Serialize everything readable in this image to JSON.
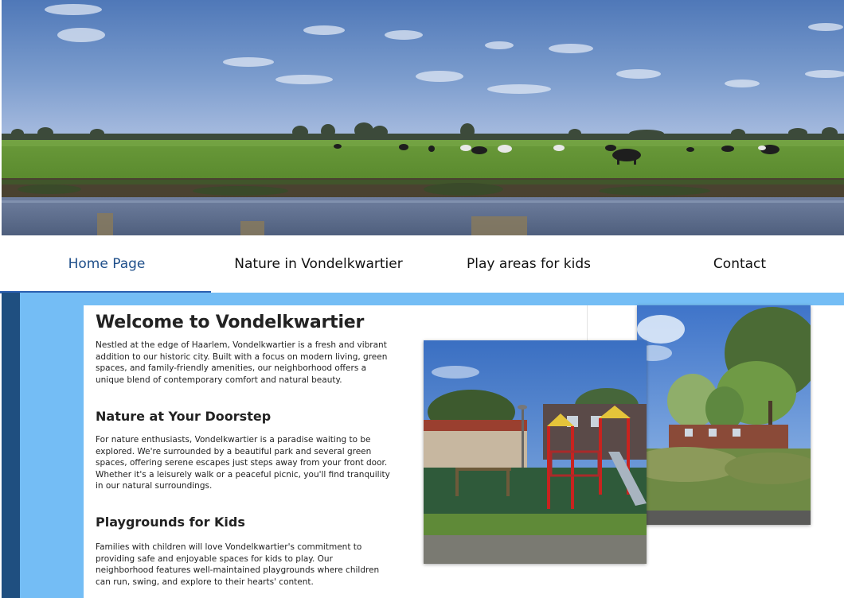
{
  "hero": {
    "image_label": "Meadow with grazing cows and a canal"
  },
  "nav": {
    "items": [
      {
        "label": "Home Page",
        "active": true
      },
      {
        "label": "Nature in Vondelkwartier",
        "active": false
      },
      {
        "label": "Play areas for kids",
        "active": false
      },
      {
        "label": "Contact",
        "active": false
      }
    ]
  },
  "main": {
    "title": "Welcome to Vondelkwartier",
    "intro": "Nestled at the edge of Haarlem, Vondelkwartier is a fresh and vibrant addition to our historic city. Built with a focus on modern living, green spaces, and family-friendly amenities, our neighborhood offers a unique blend of contemporary comfort and natural beauty.",
    "sections": [
      {
        "heading": "Nature at Your Doorstep",
        "body": "For nature enthusiasts, Vondelkwartier is a paradise waiting to be explored. We're surrounded by a beautiful park and several green spaces, offering serene escapes just steps away from your front door. Whether it's a leisurely walk or a peaceful picnic, you'll find tranquility in our natural surroundings."
      },
      {
        "heading": "Playgrounds for Kids",
        "body": "Families with children will love Vondelkwartier's commitment to providing safe and enjoyable spaces for kids to play. Our neighborhood features well-maintained playgrounds where children can run, swing, and explore to their hearts' content."
      }
    ]
  },
  "colors": {
    "accent": "#2a5fb0",
    "active_nav_text": "#1f4f8a",
    "content_background": "#74bdf5",
    "left_stripe": "#1f4f80"
  }
}
